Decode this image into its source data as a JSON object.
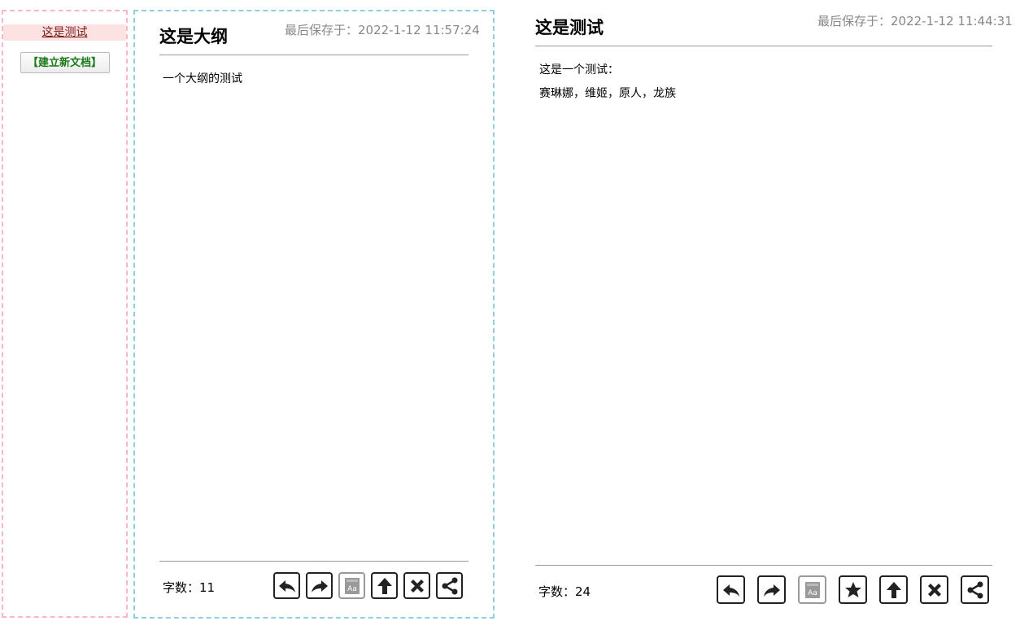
{
  "sidebar": {
    "items": [
      {
        "label": "这是测试"
      }
    ],
    "new_doc_label": "【建立新文档】"
  },
  "outline": {
    "title": "这是大纲",
    "last_saved": "最后保存于：2022-1-12 11:57:24",
    "body": [
      "一个大纲的测试"
    ],
    "word_count": "字数：11"
  },
  "document": {
    "title": "这是测试",
    "last_saved": "最后保存于：2022-1-12 11:44:31",
    "body": [
      "这是一个测试：",
      "赛琳娜，维姬，原人，龙族"
    ],
    "word_count": "字数：24"
  },
  "colors": {
    "sidebar_border": "#f5b8c8",
    "outline_border": "#8fd0e0",
    "active_item_bg": "#fde2e2",
    "new_doc_text": "#1a7a1a"
  },
  "icons": [
    "undo-icon",
    "redo-icon",
    "font-icon",
    "star-icon",
    "arrow-up-icon",
    "close-icon",
    "share-icon"
  ]
}
